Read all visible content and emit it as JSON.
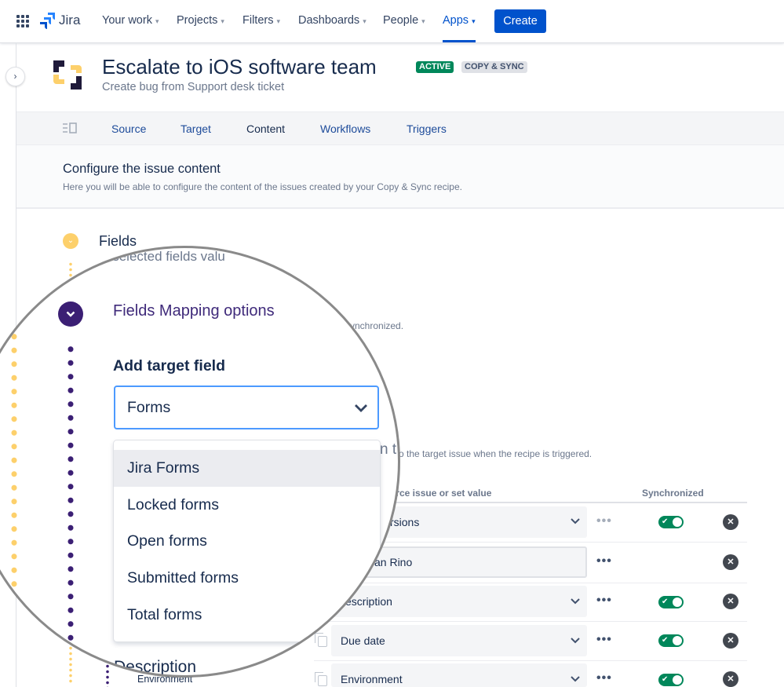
{
  "nav": {
    "product": "Jira",
    "items": [
      {
        "label": "Your work"
      },
      {
        "label": "Projects"
      },
      {
        "label": "Filters"
      },
      {
        "label": "Dashboards"
      },
      {
        "label": "People"
      },
      {
        "label": "Apps",
        "active": true
      }
    ],
    "create_label": "Create"
  },
  "header": {
    "title": "Escalate to iOS software team",
    "subtitle": "Create bug from Support desk ticket",
    "status_badge": "ACTIVE",
    "type_badge": "COPY & SYNC"
  },
  "tabs": [
    {
      "label": "Source"
    },
    {
      "label": "Target"
    },
    {
      "label": "Content",
      "active": true
    },
    {
      "label": "Workflows"
    },
    {
      "label": "Triggers"
    }
  ],
  "config": {
    "title": "Configure the issue content",
    "description": "Here you will be able to configure the content of the issues created by your Copy & Sync recipe."
  },
  "fields_step": {
    "title": "Fields",
    "description_fragment": "y selected fields valu"
  },
  "mapping": {
    "title": "Fields Mapping options",
    "description_fragment": "synchronized.",
    "add_target_label": "Add target field",
    "select_value": "Forms",
    "options": [
      "Jira Forms",
      "Locked forms",
      "Open forms",
      "Submitted forms",
      "Total forms"
    ],
    "highlighted": "Jira Forms",
    "section_fragment": "n t",
    "section_desc_fragment": "o the target issue when the recipe is triggered.",
    "next_section": "Description"
  },
  "table": {
    "col_source_fragment": "urce issue or set value",
    "col_sync": "Synchronized",
    "rows": [
      {
        "target": "",
        "value": "rsions",
        "sync": true,
        "dots_muted": true
      },
      {
        "target": "",
        "value": "yan Rino",
        "sync": null
      },
      {
        "target": "",
        "value": "escription",
        "sync": true
      },
      {
        "target": "",
        "value": "Due date",
        "sync": true
      },
      {
        "target": "Environment",
        "value": "Environment",
        "sync": true
      }
    ]
  },
  "colors": {
    "primary": "#0052cc",
    "active_green": "#00875a",
    "step_yellow": "#fdd06b",
    "step_purple": "#3b1f74",
    "focus": "#4c9aff"
  }
}
